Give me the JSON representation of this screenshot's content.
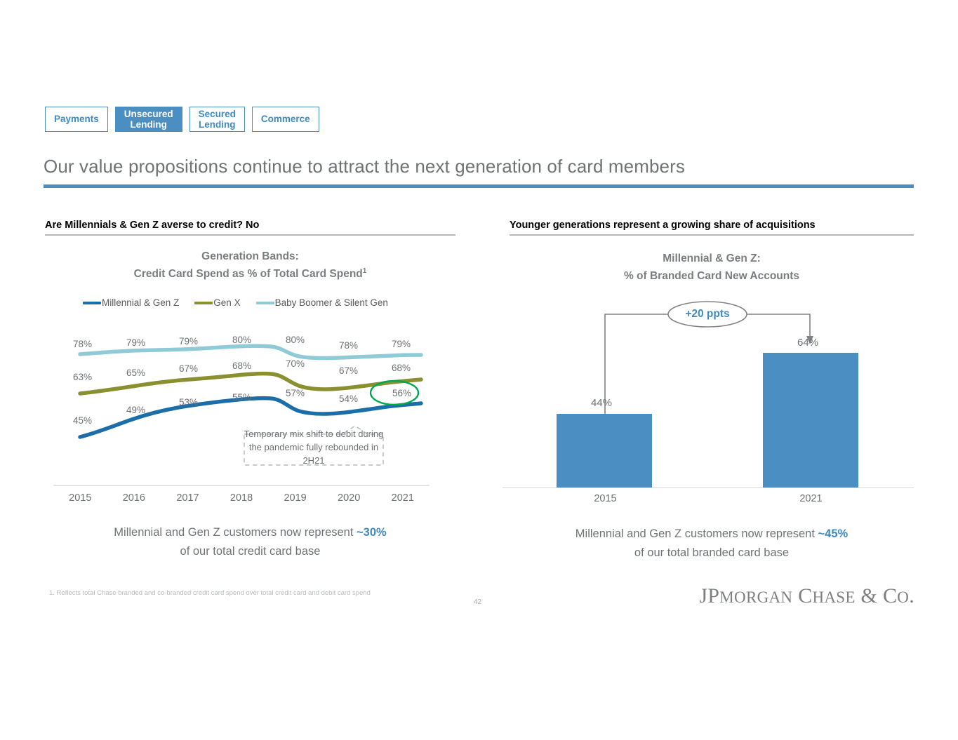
{
  "tabs": [
    {
      "label": "Payments",
      "active": false
    },
    {
      "label": "Unsecured\nLending",
      "active": true
    },
    {
      "label": "Secured\nLending",
      "active": false
    },
    {
      "label": "Commerce",
      "active": false
    }
  ],
  "page_title": "Our value propositions continue to attract the next generation of card members",
  "left_panel": {
    "heading": "Are Millennials & Gen Z averse to credit? No",
    "subtitle_line1": "Generation Bands:",
    "subtitle_line2": "Credit Card Spend as % of Total Card Spend",
    "subtitle_footnote_marker": "1",
    "callout": "Temporary mix shift to debit during the pandemic fully rebounded in 2H21",
    "caption_prefix": "Millennial and Gen Z customers now represent ",
    "caption_highlight": "~30%",
    "caption_suffix": "of our total credit card base"
  },
  "right_panel": {
    "heading": "Younger generations represent a growing share of acquisitions",
    "subtitle_line1": "Millennial & Gen Z:",
    "subtitle_line2": "% of Branded Card New Accounts",
    "delta_badge": "+20 ppts",
    "caption_prefix": "Millennial and Gen Z customers now represent ",
    "caption_highlight": "~45%",
    "caption_suffix": "of our total branded card base"
  },
  "footnote": "1. Reflects total Chase branded and co-branded credit card spend over total credit card and debit card spend",
  "page_number": "42",
  "logo": "JPMorgan Chase & Co.",
  "colors": {
    "accent_blue": "#4a8ec2",
    "millennial_genz": "#1b6ea8",
    "gen_x": "#8a9030",
    "baby_boomer": "#8fcbd6",
    "highlight_green": "#00a94f",
    "title_gray": "#6f7376"
  },
  "chart_data": [
    {
      "type": "line",
      "title": "Generation Bands: Credit Card Spend as % of Total Card Spend",
      "xlabel": "",
      "ylabel": "",
      "ylim": [
        40,
        85
      ],
      "grid": false,
      "legend_position": "top",
      "x": [
        "2015",
        "2016",
        "2017",
        "2018",
        "2019",
        "2020",
        "2021"
      ],
      "series": [
        {
          "name": "Millennial & Gen Z",
          "color": "#1b6ea8",
          "values": [
            45,
            49,
            53,
            55,
            57,
            54,
            56
          ],
          "labels": [
            "45%",
            "49%",
            "53%",
            "55%",
            "57%",
            "54%",
            "56%"
          ]
        },
        {
          "name": "Gen X",
          "color": "#8a9030",
          "values": [
            63,
            65,
            67,
            68,
            70,
            67,
            68
          ],
          "labels": [
            "63%",
            "65%",
            "67%",
            "68%",
            "70%",
            "67%",
            "68%"
          ]
        },
        {
          "name": "Baby Boomer & Silent Gen",
          "color": "#8fcbd6",
          "values": [
            78,
            79,
            79,
            80,
            80,
            78,
            79
          ],
          "labels": [
            "78%",
            "79%",
            "79%",
            "80%",
            "80%",
            "78%",
            "79%"
          ]
        }
      ],
      "annotations": [
        {
          "text": "Temporary mix shift to debit during the pandemic fully rebounded in 2H21",
          "points_to": "2020"
        },
        {
          "text": "56%",
          "style": "green-ellipse-highlight",
          "points_to": "2021"
        }
      ]
    },
    {
      "type": "bar",
      "title": "Millennial & Gen Z: % of Branded Card New Accounts",
      "xlabel": "",
      "ylabel": "",
      "ylim": [
        0,
        70
      ],
      "grid": false,
      "categories": [
        "2015",
        "2021"
      ],
      "values": [
        44,
        64
      ],
      "labels": [
        "44%",
        "64%"
      ],
      "color": "#4a8ec2",
      "annotations": [
        {
          "text": "+20 ppts",
          "style": "blue-ellipse-badge",
          "from": "2015",
          "to": "2021"
        }
      ]
    }
  ]
}
